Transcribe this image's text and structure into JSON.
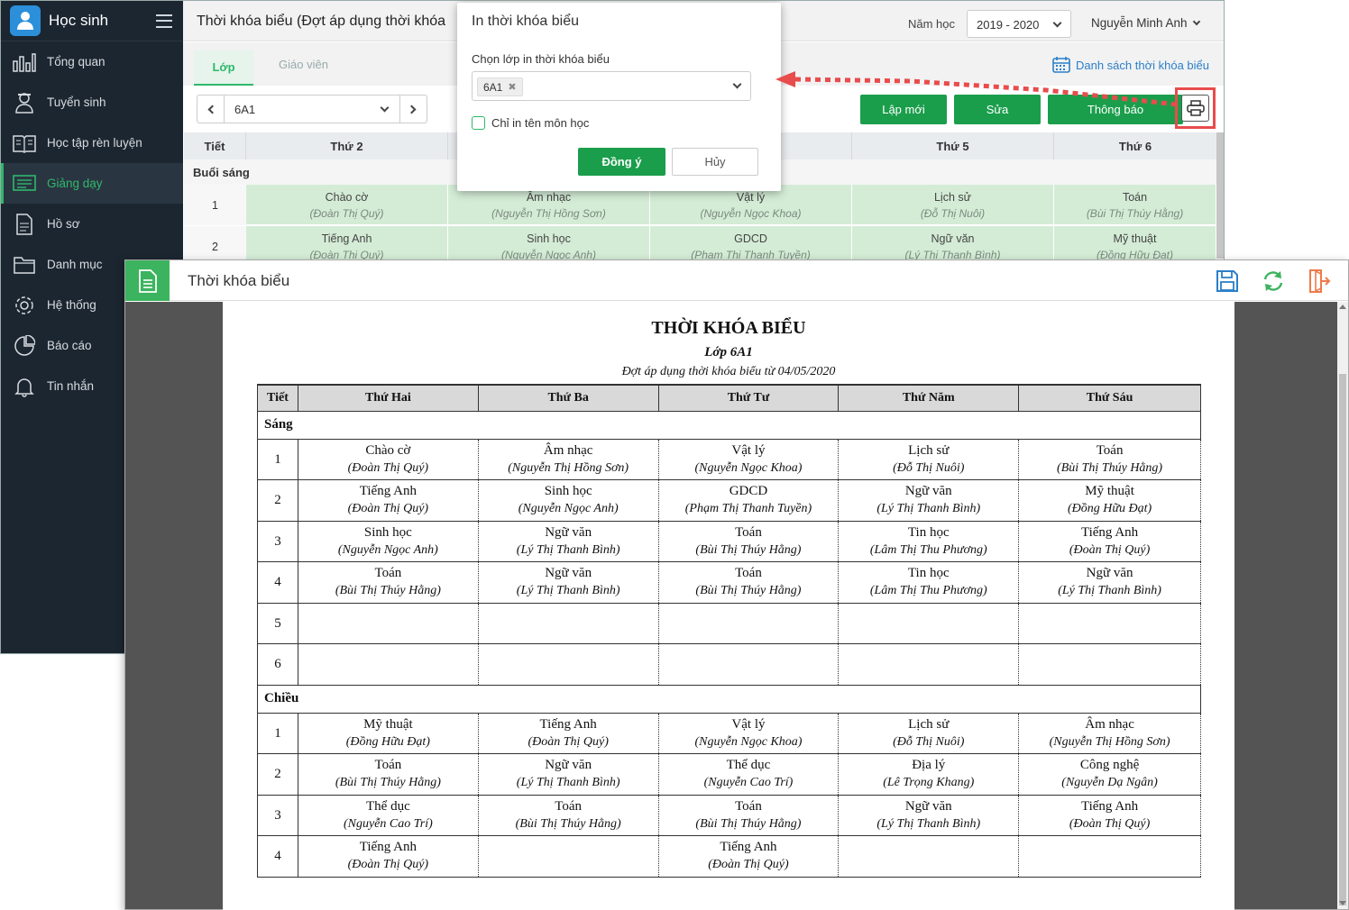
{
  "app": {
    "brand": "Học sinh",
    "page_title": "Thời khóa biểu (Đợt áp dụng thời khóa",
    "year_label": "Năm học",
    "year_value": "2019 - 2020",
    "user_name": "Nguyễn Minh Anh",
    "tabs": [
      "Lớp",
      "Giáo viên"
    ],
    "schedule_list_link": "Danh sách thời khóa biểu",
    "class_value": "6A1",
    "buttons": {
      "new": "Lập mới",
      "edit": "Sửa",
      "notify": "Thông báo"
    },
    "sidebar": [
      {
        "label": "Tổng quan",
        "icon": "chart-icon"
      },
      {
        "label": "Tuyển sinh",
        "icon": "student-icon"
      },
      {
        "label": "Học tập rèn luyện",
        "icon": "book-icon"
      },
      {
        "label": "Giảng dạy",
        "icon": "teaching-icon",
        "active": true
      },
      {
        "label": "Hồ sơ",
        "icon": "document-icon"
      },
      {
        "label": "Danh mục",
        "icon": "folder-icon"
      },
      {
        "label": "Hệ thống",
        "icon": "gear-icon"
      },
      {
        "label": "Báo cáo",
        "icon": "pie-chart-icon"
      },
      {
        "label": "Tin nhắn",
        "icon": "bell-icon"
      }
    ],
    "grid": {
      "headers": [
        "Tiết",
        "Thứ 2",
        "",
        "",
        "Thứ 5",
        "Thứ 6"
      ],
      "session": "Buổi sáng",
      "rows": [
        {
          "num": "1",
          "cells": [
            [
              "Chào cờ",
              "(Đoàn Thị Quý)"
            ],
            [
              "Âm nhạc",
              "(Nguyễn Thị Hồng Sơn)"
            ],
            [
              "Vật lý",
              "(Nguyễn Ngọc Khoa)"
            ],
            [
              "Lịch sử",
              "(Đỗ Thị Nuôi)"
            ],
            [
              "Toán",
              "(Bùi Thị Thúy Hằng)"
            ]
          ]
        },
        {
          "num": "2",
          "cells": [
            [
              "Tiếng Anh",
              "(Đoàn Thị Quý)"
            ],
            [
              "Sinh học",
              "(Nguyễn Ngọc Anh)"
            ],
            [
              "GDCD",
              "(Phạm Thị Thanh Tuyền)"
            ],
            [
              "Ngữ văn",
              "(Lý Thị Thanh Bình)"
            ],
            [
              "Mỹ thuật",
              "(Đồng Hữu Đạt)"
            ]
          ]
        }
      ]
    }
  },
  "dialog": {
    "title": "In thời khóa biểu",
    "select_label": "Chọn lớp in thời khóa biểu",
    "selected_chip": "6A1",
    "chip_remove": "✖",
    "checkbox_label": "Chỉ in tên môn học",
    "ok": "Đồng ý",
    "cancel": "Hủy"
  },
  "preview": {
    "title": "Thời khóa biểu",
    "tools": [
      "save-icon",
      "refresh-icon",
      "exit-icon"
    ],
    "doc": {
      "title": "THỜI KHÓA BIỂU",
      "class": "Lớp 6A1",
      "date": "Đợt áp dụng thời khóa biểu từ 04/05/2020",
      "headers": [
        "Tiết",
        "Thứ Hai",
        "Thứ Ba",
        "Thứ Tư",
        "Thứ Năm",
        "Thứ Sáu"
      ],
      "sessions": [
        {
          "name": "Sáng",
          "rows": [
            {
              "num": "1",
              "cells": [
                [
                  "Chào cờ",
                  "(Đoàn Thị Quý)"
                ],
                [
                  "Âm nhạc",
                  "(Nguyễn Thị Hồng Sơn)"
                ],
                [
                  "Vật lý",
                  "(Nguyễn Ngọc Khoa)"
                ],
                [
                  "Lịch sử",
                  "(Đỗ Thị Nuôi)"
                ],
                [
                  "Toán",
                  "(Bùi Thị Thúy Hằng)"
                ]
              ]
            },
            {
              "num": "2",
              "cells": [
                [
                  "Tiếng Anh",
                  "(Đoàn Thị Quý)"
                ],
                [
                  "Sinh học",
                  "(Nguyễn Ngọc Anh)"
                ],
                [
                  "GDCD",
                  "(Phạm Thị Thanh Tuyền)"
                ],
                [
                  "Ngữ văn",
                  "(Lý Thị Thanh Bình)"
                ],
                [
                  "Mỹ thuật",
                  "(Đồng Hữu Đạt)"
                ]
              ]
            },
            {
              "num": "3",
              "cells": [
                [
                  "Sinh học",
                  "(Nguyễn Ngọc Anh)"
                ],
                [
                  "Ngữ văn",
                  "(Lý Thị Thanh Bình)"
                ],
                [
                  "Toán",
                  "(Bùi Thị Thúy Hằng)"
                ],
                [
                  "Tin học",
                  "(Lâm Thị Thu Phương)"
                ],
                [
                  "Tiếng Anh",
                  "(Đoàn Thị Quý)"
                ]
              ]
            },
            {
              "num": "4",
              "cells": [
                [
                  "Toán",
                  "(Bùi Thị Thúy Hằng)"
                ],
                [
                  "Ngữ văn",
                  "(Lý Thị Thanh Bình)"
                ],
                [
                  "Toán",
                  "(Bùi Thị Thúy Hằng)"
                ],
                [
                  "Tin học",
                  "(Lâm Thị Thu Phương)"
                ],
                [
                  "Ngữ văn",
                  "(Lý Thị Thanh Bình)"
                ]
              ]
            },
            {
              "num": "5",
              "cells": [
                [
                  "",
                  ""
                ],
                [
                  "",
                  ""
                ],
                [
                  "",
                  ""
                ],
                [
                  "",
                  ""
                ],
                [
                  "",
                  ""
                ]
              ]
            },
            {
              "num": "6",
              "cells": [
                [
                  "",
                  ""
                ],
                [
                  "",
                  ""
                ],
                [
                  "",
                  ""
                ],
                [
                  "",
                  ""
                ],
                [
                  "",
                  ""
                ]
              ]
            }
          ]
        },
        {
          "name": "Chiều",
          "rows": [
            {
              "num": "1",
              "cells": [
                [
                  "Mỹ thuật",
                  "(Đồng Hữu Đạt)"
                ],
                [
                  "Tiếng Anh",
                  "(Đoàn Thị Quý)"
                ],
                [
                  "Vật lý",
                  "(Nguyễn Ngọc Khoa)"
                ],
                [
                  "Lịch sử",
                  "(Đỗ Thị Nuôi)"
                ],
                [
                  "Âm nhạc",
                  "(Nguyễn Thị Hồng Sơn)"
                ]
              ]
            },
            {
              "num": "2",
              "cells": [
                [
                  "Toán",
                  "(Bùi Thị Thúy Hằng)"
                ],
                [
                  "Ngữ văn",
                  "(Lý Thị Thanh Bình)"
                ],
                [
                  "Thể dục",
                  "(Nguyễn Cao Trí)"
                ],
                [
                  "Địa lý",
                  "(Lê Trọng Khang)"
                ],
                [
                  "Công nghệ",
                  "(Nguyễn Dạ Ngân)"
                ]
              ]
            },
            {
              "num": "3",
              "cells": [
                [
                  "Thể dục",
                  "(Nguyễn Cao Trí)"
                ],
                [
                  "Toán",
                  "(Bùi Thị Thúy Hằng)"
                ],
                [
                  "Toán",
                  "(Bùi Thị Thúy Hằng)"
                ],
                [
                  "Ngữ văn",
                  "(Lý Thị Thanh Bình)"
                ],
                [
                  "Tiếng Anh",
                  "(Đoàn Thị Quý)"
                ]
              ]
            },
            {
              "num": "4",
              "cells": [
                [
                  "Tiếng Anh",
                  "(Đoàn Thị Quý)"
                ],
                [
                  "",
                  ""
                ],
                [
                  "Tiếng Anh",
                  "(Đoàn Thị Quý)"
                ],
                [
                  "",
                  ""
                ],
                [
                  "",
                  ""
                ]
              ]
            }
          ]
        }
      ]
    }
  },
  "colors": {
    "accent": "#1a9e4b",
    "sidebar_bg": "#1c2630",
    "highlight": "#e84c4c",
    "link": "#2b7fc9"
  }
}
